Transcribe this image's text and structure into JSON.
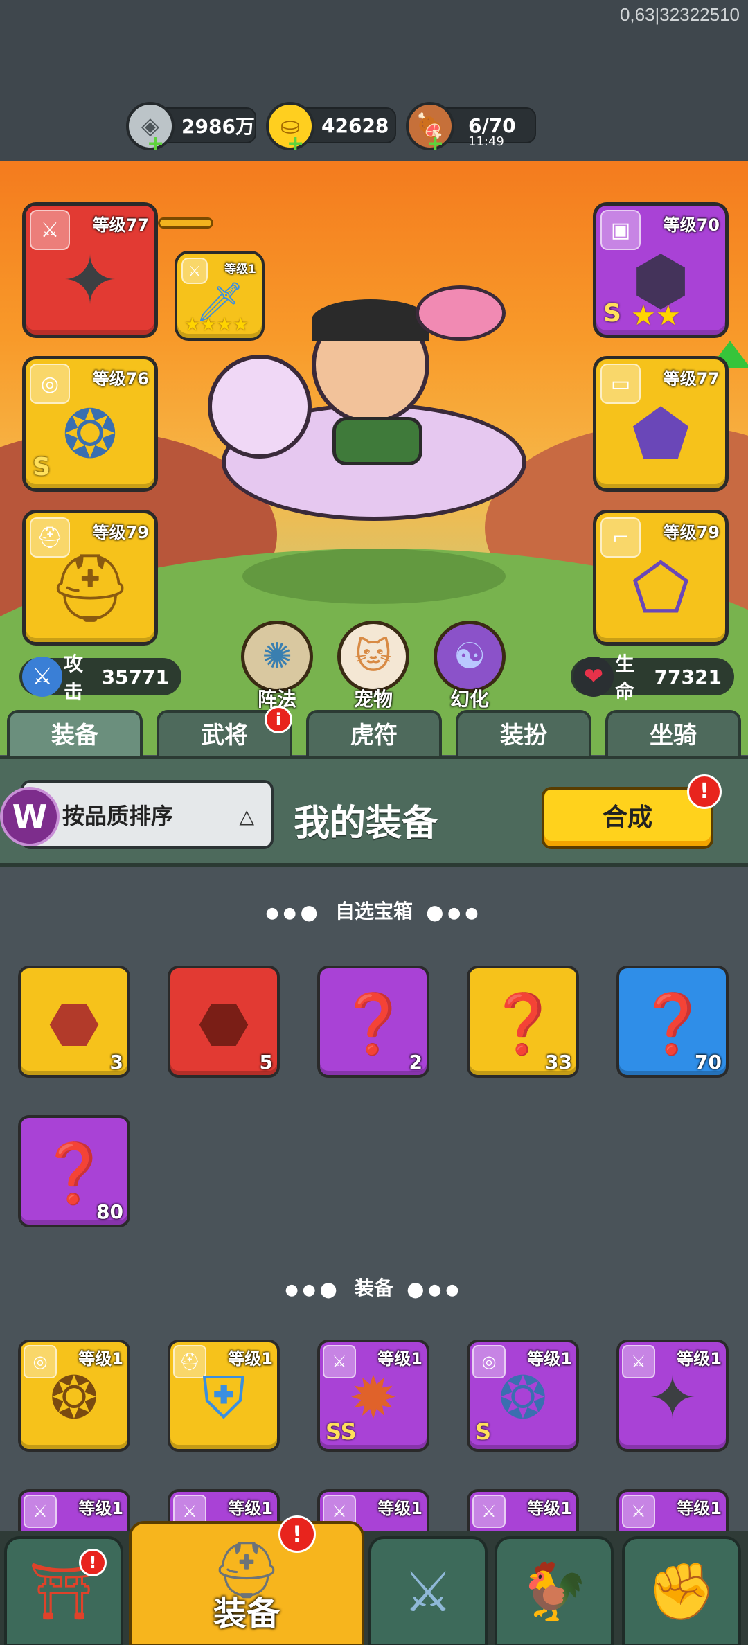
{
  "debug_text": "0,63|32322510",
  "resources": {
    "silver": {
      "value": "2986万",
      "icon": "coin-icon"
    },
    "gold": {
      "value": "42628",
      "icon": "gold-ingot-icon"
    },
    "stamina": {
      "value": "6/70",
      "timer": "11:49",
      "icon": "meat-icon"
    }
  },
  "equipment_slots": {
    "weapon": {
      "level": "等级77",
      "quality": "red"
    },
    "weapon_attach": {
      "level": "等级1"
    },
    "necklace": {
      "level": "等级76",
      "grade": "S"
    },
    "helmet": {
      "level": "等级79"
    },
    "armor": {
      "level": "等级70",
      "grade": "S"
    },
    "accessory": {
      "level": "等级77"
    },
    "boots": {
      "level": "等级79"
    }
  },
  "stats": {
    "attack_label": "攻击",
    "attack_value": "35771",
    "hp_label": "生命",
    "hp_value": "77321"
  },
  "functions": [
    {
      "label": "阵法"
    },
    {
      "label": "宠物"
    },
    {
      "label": "幻化"
    }
  ],
  "tabs": [
    {
      "label": "装备",
      "active": true
    },
    {
      "label": "武将",
      "badge": "i"
    },
    {
      "label": "虎符"
    },
    {
      "label": "装扮"
    },
    {
      "label": "坐骑"
    }
  ],
  "panel": {
    "sort_label": "按品质排序",
    "title": "我的装备",
    "combine_label": "合成",
    "combine_badge": "!"
  },
  "chest_section": {
    "title": "自选宝箱",
    "items": [
      {
        "count": "3",
        "quality": "yellow"
      },
      {
        "count": "5",
        "quality": "red"
      },
      {
        "count": "2",
        "quality": "purple"
      },
      {
        "count": "33",
        "quality": "yellow"
      },
      {
        "count": "70",
        "quality": "blue"
      },
      {
        "count": "80",
        "quality": "purple"
      }
    ]
  },
  "equip_section": {
    "title": "装备",
    "items": [
      {
        "level": "等级1",
        "quality": "yellow"
      },
      {
        "level": "等级1",
        "quality": "yellow"
      },
      {
        "level": "等级1",
        "quality": "purple",
        "grade": "SS"
      },
      {
        "level": "等级1",
        "quality": "purple",
        "grade": "S"
      },
      {
        "level": "等级1",
        "quality": "purple"
      },
      {
        "level": "等级1",
        "quality": "purple"
      },
      {
        "level": "等级1",
        "quality": "purple"
      },
      {
        "level": "等级1",
        "quality": "purple"
      },
      {
        "level": "等级1",
        "quality": "purple"
      },
      {
        "level": "等级1",
        "quality": "purple"
      }
    ]
  },
  "bottom_nav": {
    "active_label": "装备",
    "active_badge": "!",
    "items": [
      "shop",
      "equipment",
      "battle",
      "pet",
      "upgrade"
    ]
  }
}
